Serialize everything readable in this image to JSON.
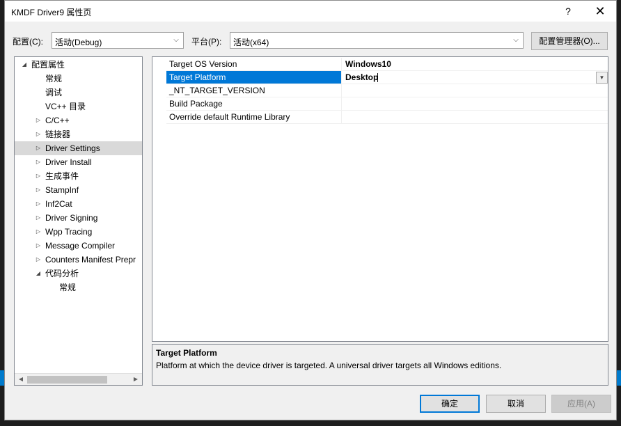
{
  "window": {
    "title": "KMDF Driver9 属性页",
    "help_glyph": "?",
    "close_glyph": "✕"
  },
  "config": {
    "label": "配置(C):",
    "value": "活动(Debug)"
  },
  "platform": {
    "label": "平台(P):",
    "value": "活动(x64)"
  },
  "config_manager_label": "配置管理器(O)...",
  "tree": {
    "items": [
      {
        "label": "配置属性",
        "expander": "◢"
      },
      {
        "label": "常规",
        "expander": ""
      },
      {
        "label": "调试",
        "expander": ""
      },
      {
        "label": "VC++ 目录",
        "expander": ""
      },
      {
        "label": "C/C++",
        "expander": "▷"
      },
      {
        "label": "链接器",
        "expander": "▷"
      },
      {
        "label": "Driver Settings",
        "expander": "▷"
      },
      {
        "label": "Driver Install",
        "expander": "▷"
      },
      {
        "label": "生成事件",
        "expander": "▷"
      },
      {
        "label": "StampInf",
        "expander": "▷"
      },
      {
        "label": "Inf2Cat",
        "expander": "▷"
      },
      {
        "label": "Driver Signing",
        "expander": "▷"
      },
      {
        "label": "Wpp Tracing",
        "expander": "▷"
      },
      {
        "label": "Message Compiler",
        "expander": "▷"
      },
      {
        "label": "Counters Manifest Prepr",
        "expander": "▷"
      },
      {
        "label": "代码分析",
        "expander": "◢"
      },
      {
        "label": "常规",
        "expander": ""
      }
    ],
    "selected": "Driver Settings"
  },
  "properties": [
    {
      "name": "Target OS Version",
      "value": "Windows10"
    },
    {
      "name": "Target Platform",
      "value": "Desktop"
    },
    {
      "name": "_NT_TARGET_VERSION",
      "value": ""
    },
    {
      "name": "Build Package",
      "value": ""
    },
    {
      "name": "Override default Runtime Library",
      "value": ""
    }
  ],
  "description": {
    "title": "Target Platform",
    "text": "Platform at which the device driver is targeted. A universal driver targets all Windows editions."
  },
  "buttons": {
    "ok": "确定",
    "cancel": "取消",
    "apply": "应用(A)"
  },
  "colors": {
    "selection": "#0078d7",
    "tree_selection": "#d9d9d9"
  }
}
